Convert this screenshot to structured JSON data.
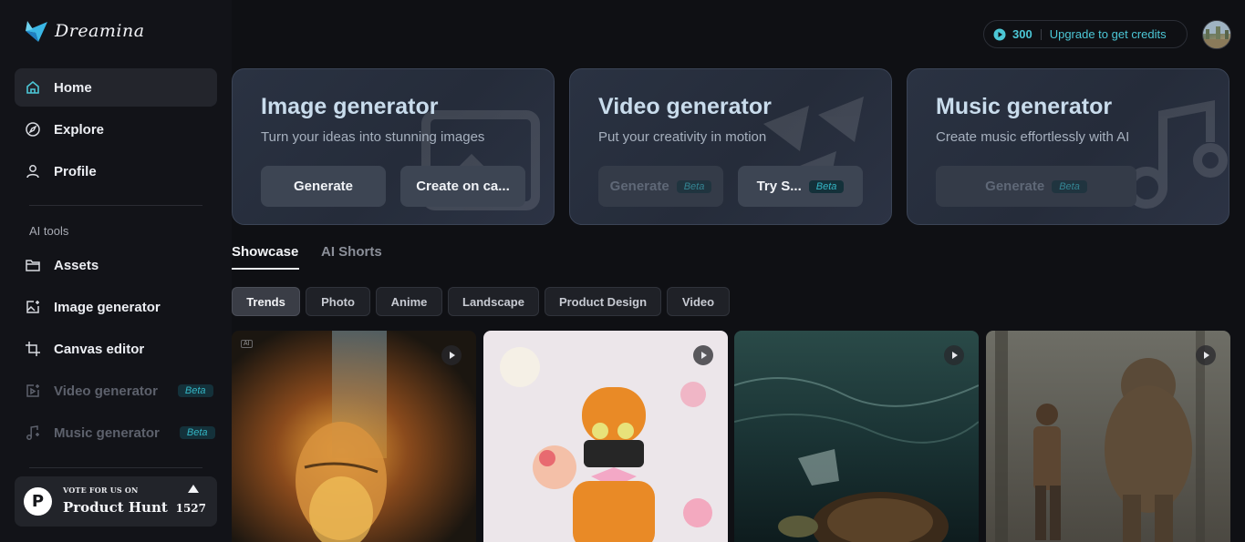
{
  "app": {
    "logo_text": "Dreamina",
    "accent": "#4cc7d6"
  },
  "sidebar": {
    "items": [
      {
        "label": "Home",
        "icon": "home-icon",
        "active": true
      },
      {
        "label": "Explore",
        "icon": "compass-icon"
      },
      {
        "label": "Profile",
        "icon": "user-icon"
      }
    ],
    "tools_label": "AI tools",
    "tools": [
      {
        "label": "Assets",
        "icon": "folder-icon"
      },
      {
        "label": "Image generator",
        "icon": "image-plus-icon"
      },
      {
        "label": "Canvas editor",
        "icon": "crop-icon"
      },
      {
        "label": "Video generator",
        "icon": "video-plus-icon",
        "disabled": true,
        "badge": "Beta"
      },
      {
        "label": "Music generator",
        "icon": "music-note-icon",
        "disabled": true,
        "badge": "Beta"
      }
    ],
    "product_hunt": {
      "vote_label": "VOTE FOR US ON",
      "name": "Product Hunt",
      "logo_letter": "P",
      "count": "1527"
    }
  },
  "header": {
    "credits": "300",
    "upgrade_label": "Upgrade to get credits"
  },
  "generators": [
    {
      "title": "Image generator",
      "subtitle": "Turn your ideas into stunning images",
      "buttons": [
        {
          "label": "Generate"
        },
        {
          "label": "Create on ca..."
        }
      ]
    },
    {
      "title": "Video generator",
      "subtitle": "Put your creativity in motion",
      "buttons": [
        {
          "label": "Generate",
          "badge": "Beta",
          "disabled": true
        },
        {
          "label": "Try S...",
          "badge": "Beta"
        }
      ]
    },
    {
      "title": "Music generator",
      "subtitle": "Create music effortlessly with AI",
      "buttons": [
        {
          "label": "Generate",
          "badge": "Beta",
          "disabled": true
        }
      ]
    }
  ],
  "tabs": [
    {
      "label": "Showcase",
      "active": true
    },
    {
      "label": "AI Shorts"
    }
  ],
  "filters": [
    {
      "label": "Trends",
      "active": true
    },
    {
      "label": "Photo"
    },
    {
      "label": "Anime"
    },
    {
      "label": "Landscape"
    },
    {
      "label": "Product Design"
    },
    {
      "label": "Video"
    }
  ],
  "showcase": [
    {
      "subject": "Glowing golden woman face by waterfall",
      "ai_tag": "AI"
    },
    {
      "subject": "Orange robot holding flowers"
    },
    {
      "subject": "Sea turtle underwater with plastic"
    },
    {
      "subject": "Boy facing furry forest creature"
    }
  ]
}
